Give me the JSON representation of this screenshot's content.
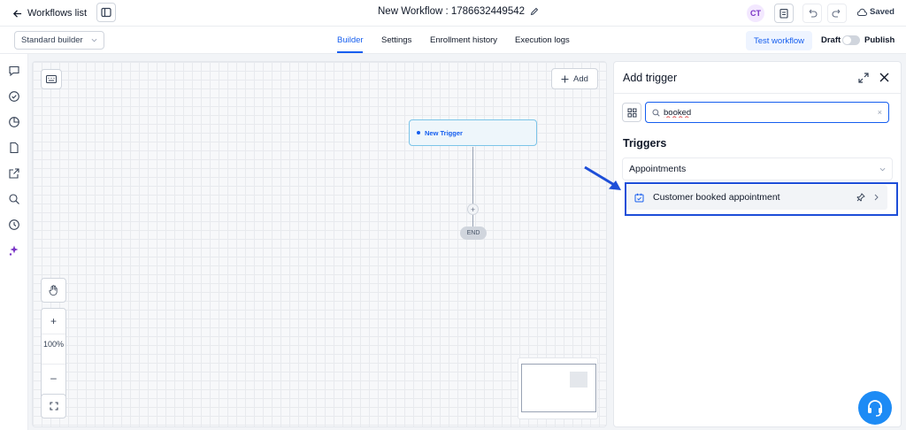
{
  "header": {
    "back_label": "Workflows list",
    "workflow_title": "New Workflow : 1786632449542",
    "avatar_initials": "CT",
    "saved_label": "Saved"
  },
  "subbar": {
    "builder_select": "Standard builder",
    "tabs": [
      {
        "label": "Builder",
        "active": true
      },
      {
        "label": "Settings",
        "active": false
      },
      {
        "label": "Enrollment history",
        "active": false
      },
      {
        "label": "Execution logs",
        "active": false
      }
    ],
    "test_button": "Test workflow",
    "draft_label": "Draft",
    "publish_label": "Publish"
  },
  "canvas": {
    "add_button": "Add",
    "trigger_node": "New Trigger",
    "end_label": "END",
    "zoom_level": "100%"
  },
  "panel": {
    "title": "Add trigger",
    "search_value": "booked",
    "section_heading": "Triggers",
    "group_label": "Appointments",
    "item_label": "Customer booked appointment"
  },
  "colors": {
    "accent": "#155eef",
    "highlight": "#1d4ed8",
    "node_border": "#7cc4e8"
  }
}
